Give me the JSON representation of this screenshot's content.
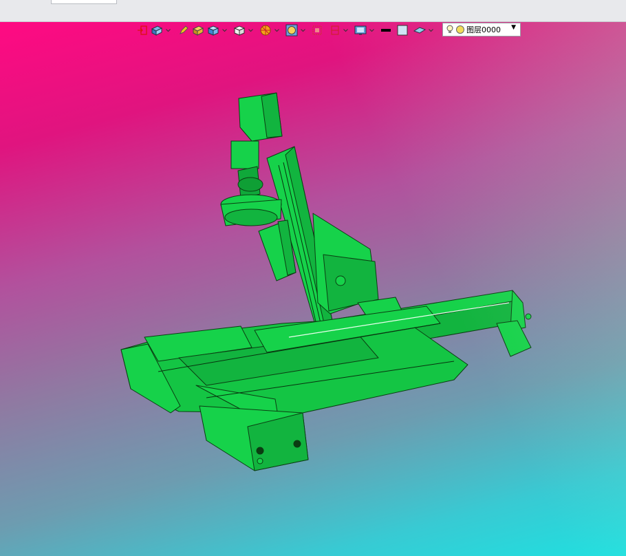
{
  "top_bar": {
    "caption": ""
  },
  "toolbar": {
    "icons": [
      "exit-sketch-icon",
      "view-orientation-icon",
      "pen-icon",
      "box-solid-icon",
      "shaded-cube-icon",
      "wireframe-cube-icon",
      "section-color-icon",
      "zoom-circle-icon",
      "fit-view-icon",
      "clip-plane-icon",
      "display-settings-icon",
      "line-black-icon",
      "fill-lightblue-icon",
      "surface-icon"
    ]
  },
  "layer": {
    "bulb_icon": "lightbulb-icon",
    "sun_icon": "sun-icon",
    "label": "图层0000"
  },
  "colors": {
    "model_green": "#16d24a",
    "gradient_top": "#ff0a82",
    "gradient_bottom": "#1fe0e0"
  }
}
